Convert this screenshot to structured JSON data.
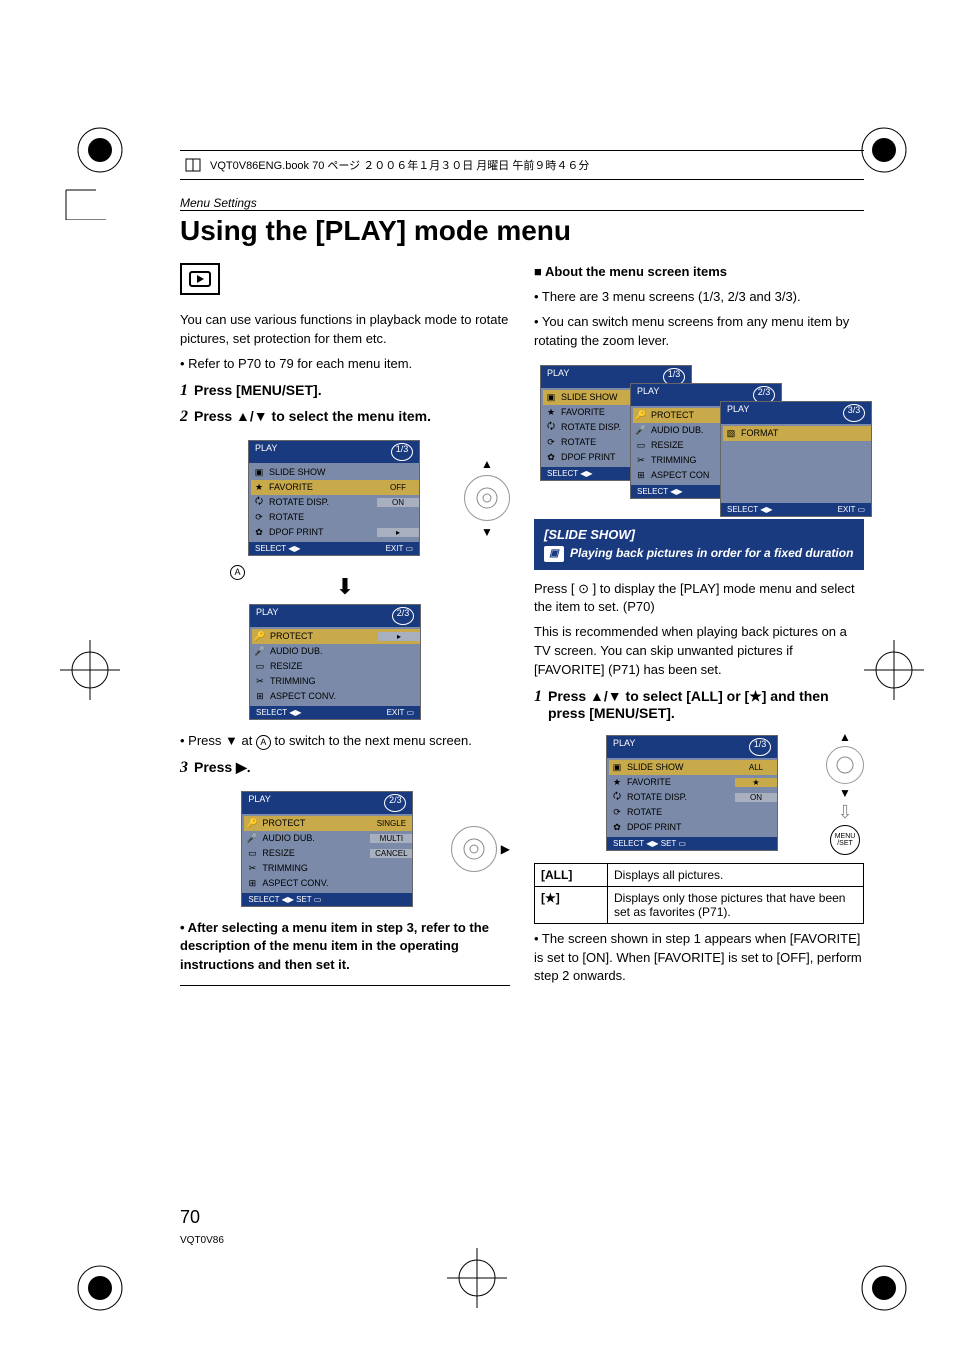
{
  "headerLine": "VQT0V86ENG.book  70 ページ  ２００６年１月３０日  月曜日  午前９時４６分",
  "sectionLabel": "Menu Settings",
  "title": "Using the [PLAY] mode menu",
  "left": {
    "intro1": "You can use various functions in playback mode to rotate pictures, set protection for them etc.",
    "intro2": "• Refer to P70 to 79 for each menu item.",
    "step1": "Press [MENU/SET].",
    "step2": "Press ▲/▼ to select the menu item.",
    "menu1": {
      "title": "PLAY",
      "page": "1/3",
      "rows": [
        {
          "icon": "▣",
          "label": "SLIDE SHOW"
        },
        {
          "icon": "★",
          "label": "FAVORITE",
          "val": "OFF",
          "hl": true
        },
        {
          "icon": "🗘",
          "label": "ROTATE DISP.",
          "val": "ON"
        },
        {
          "icon": "⟳",
          "label": "ROTATE"
        },
        {
          "icon": "✿",
          "label": "DPOF PRINT",
          "arrow": true
        }
      ],
      "footerL": "SELECT ◀▶",
      "footerR": "EXIT ▭"
    },
    "menu2": {
      "title": "PLAY",
      "page": "2/3",
      "rows": [
        {
          "icon": "🔑",
          "label": "PROTECT",
          "arrow": true,
          "hl": true
        },
        {
          "icon": "🎤",
          "label": "AUDIO DUB."
        },
        {
          "icon": "▭",
          "label": "RESIZE"
        },
        {
          "icon": "✂",
          "label": "TRIMMING"
        },
        {
          "icon": "⊞",
          "label": "ASPECT CONV."
        }
      ],
      "footerL": "SELECT ◀▶",
      "footerR": "EXIT ▭"
    },
    "pressDown": "• Press ▼ at Ⓐ to switch to the next menu screen.",
    "step3": "Press ▶.",
    "menu3": {
      "title": "PLAY",
      "page": "2/3",
      "rows": [
        {
          "icon": "🔑",
          "label": "PROTECT",
          "val": "SINGLE",
          "hl": true
        },
        {
          "icon": "🎤",
          "label": "AUDIO DUB.",
          "val": "MULTI"
        },
        {
          "icon": "▭",
          "label": "RESIZE",
          "val": "CANCEL"
        },
        {
          "icon": "✂",
          "label": "TRIMMING"
        },
        {
          "icon": "⊞",
          "label": "ASPECT CONV."
        }
      ],
      "footerL": "SELECT ◀▶ SET ▭",
      "footerR": ""
    },
    "after": "• After selecting a menu item in step 3, refer to the description of the menu item in the operating instructions and then set it."
  },
  "right": {
    "aboutHeader": "■ About the menu screen items",
    "about1": "• There are 3 menu screens (1/3, 2/3 and 3/3).",
    "about2": "• You can switch menu screens from any menu item by rotating the zoom lever.",
    "m1": {
      "title": "PLAY",
      "page": "1/3",
      "rows": [
        {
          "icon": "▣",
          "label": "SLIDE SHOW",
          "hl": true
        },
        {
          "icon": "★",
          "label": "FAVORITE"
        },
        {
          "icon": "🗘",
          "label": "ROTATE DISP."
        },
        {
          "icon": "⟳",
          "label": "ROTATE"
        },
        {
          "icon": "✿",
          "label": "DPOF PRINT"
        }
      ],
      "footerL": "SELECT ◀▶",
      "footerR": ""
    },
    "m2": {
      "title": "PLAY",
      "page": "2/3",
      "rows": [
        {
          "icon": "🔑",
          "label": "PROTECT",
          "hl": true
        },
        {
          "icon": "🎤",
          "label": "AUDIO DUB."
        },
        {
          "icon": "▭",
          "label": "RESIZE"
        },
        {
          "icon": "✂",
          "label": "TRIMMING"
        },
        {
          "icon": "⊞",
          "label": "ASPECT CON"
        }
      ],
      "footerL": "SELECT ◀▶",
      "footerR": ""
    },
    "m3": {
      "title": "PLAY",
      "page": "3/3",
      "rows": [
        {
          "icon": "▧",
          "label": "FORMAT",
          "hl": true
        },
        {
          "label": ""
        },
        {
          "label": ""
        },
        {
          "label": ""
        },
        {
          "label": ""
        }
      ],
      "footerL": "SELECT ◀▶",
      "footerR": "EXIT ▭"
    },
    "blueTitle": "[SLIDE SHOW]",
    "blueSub": "Playing back pictures in order for a fixed duration",
    "press": "Press [ ⊙ ] to display the [PLAY] mode menu and select the item to set. (P70)",
    "note": "This is recommended when playing back pictures on a TV screen. You can skip unwanted pictures if [FAVORITE] (P71) has been set.",
    "step1": "Press ▲/▼ to select [ALL] or [★] and then press [MENU/SET].",
    "menuS": {
      "title": "PLAY",
      "page": "1/3",
      "rows": [
        {
          "icon": "▣",
          "label": "SLIDE SHOW",
          "val": "ALL",
          "hl": true
        },
        {
          "icon": "★",
          "label": "FAVORITE",
          "val": "★",
          "hlval": true
        },
        {
          "icon": "🗘",
          "label": "ROTATE DISP.",
          "val": "ON"
        },
        {
          "icon": "⟳",
          "label": "ROTATE"
        },
        {
          "icon": "✿",
          "label": "DPOF PRINT"
        }
      ],
      "footerL": "SELECT ◀▶ SET ▭",
      "footerR": ""
    },
    "tableAll": "[ALL]",
    "tableAllDesc": "Displays all pictures.",
    "tableStar": "[★]",
    "tableStarDesc": "Displays only those pictures that have been set as favorites (P71).",
    "footnote": "• The screen shown in step 1 appears when [FAVORITE] is set to [ON]. When [FAVORITE] is set to [OFF], perform step 2 onwards."
  },
  "pageNum": "70",
  "pageCode": "VQT0V86"
}
